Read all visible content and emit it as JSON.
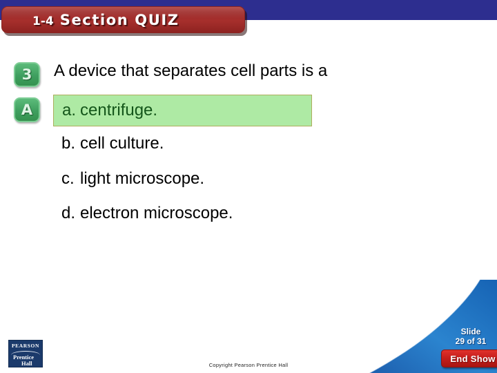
{
  "header": {
    "banner_section_number": "1-4",
    "banner_title": "Section QUIZ",
    "band_color": "#2d2e8f",
    "banner_color": "#a02b28"
  },
  "markers": {
    "question_marker": "3",
    "answer_marker": "A",
    "marker_color": "#3f9f5f"
  },
  "quiz": {
    "question": "A device that separates cell parts is a",
    "choices": [
      {
        "letter": "a.",
        "text": "centrifuge.",
        "highlighted": true
      },
      {
        "letter": "b.",
        "text": "cell culture.",
        "highlighted": false
      },
      {
        "letter": "c.",
        "text": "light microscope.",
        "highlighted": false
      },
      {
        "letter": "d.",
        "text": "electron microscope.",
        "highlighted": false
      }
    ],
    "highlight_fill": "#aeeaa4",
    "highlight_border": "#adad5c",
    "highlight_text_color": "#14561a"
  },
  "footer": {
    "slide_label": "Slide",
    "slide_position": "29 of 31",
    "end_show_label": "End Show",
    "end_show_color": "#c61f1c",
    "copyright": "Copyright Pearson Prentice Hall",
    "swoosh_color": "#1b6fc4"
  },
  "logo": {
    "brand": "PEARSON",
    "imprint_line1": "Prentice",
    "imprint_line2": "Hall",
    "background": "#1b3a6b"
  }
}
